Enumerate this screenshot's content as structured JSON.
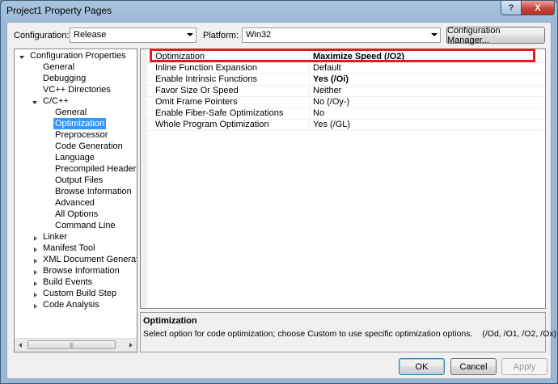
{
  "window": {
    "title": "Project1 Property Pages",
    "help_glyph": "?",
    "close_glyph": "X"
  },
  "top": {
    "configuration_label": "Configuration:",
    "configuration_value": "Release",
    "platform_label": "Platform:",
    "platform_value": "Win32",
    "config_manager_label": "Configuration Manager..."
  },
  "tree": {
    "items": [
      "Configuration Properties",
      "General",
      "Debugging",
      "VC++ Directories",
      "C/C++",
      "General",
      "Optimization",
      "Preprocessor",
      "Code Generation",
      "Language",
      "Precompiled Headers",
      "Output Files",
      "Browse Information",
      "Advanced",
      "All Options",
      "Command Line",
      "Linker",
      "Manifest Tool",
      "XML Document Generator",
      "Browse Information",
      "Build Events",
      "Custom Build Step",
      "Code Analysis"
    ],
    "scroll_grip": "|||"
  },
  "properties": [
    {
      "name": "Optimization",
      "value": "Maximize Speed (/O2)"
    },
    {
      "name": "Inline Function Expansion",
      "value": "Default"
    },
    {
      "name": "Enable Intrinsic Functions",
      "value": "Yes (/Oi)"
    },
    {
      "name": "Favor Size Or Speed",
      "value": "Neither"
    },
    {
      "name": "Omit Frame Pointers",
      "value": "No (/Oy-)"
    },
    {
      "name": "Enable Fiber-Safe Optimizations",
      "value": "No"
    },
    {
      "name": "Whole Program Optimization",
      "value": "Yes (/GL)"
    }
  ],
  "description": {
    "title": "Optimization",
    "text": "Select option for code optimization; choose Custom to use specific optimization options.",
    "options": "(/Od, /O1, /O2, /Ox)"
  },
  "buttons": {
    "ok": "OK",
    "cancel": "Cancel",
    "apply": "Apply"
  },
  "colors": {
    "highlight_box": "#e21b23",
    "selection": "#3399ff"
  }
}
